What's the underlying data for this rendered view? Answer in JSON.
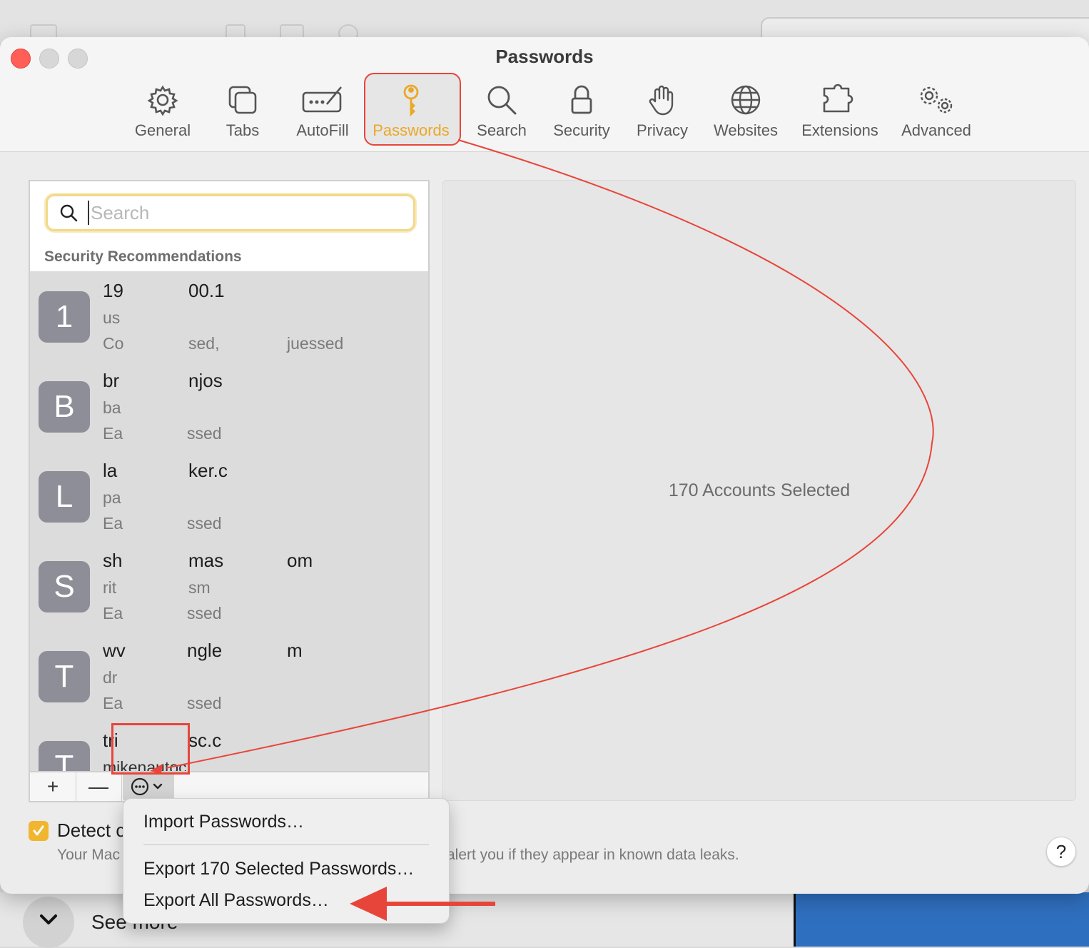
{
  "background": {
    "see_more_label": "See more"
  },
  "window": {
    "title": "Passwords",
    "tabs": [
      {
        "label": "General",
        "icon": "gear-icon"
      },
      {
        "label": "Tabs",
        "icon": "tabs-icon"
      },
      {
        "label": "AutoFill",
        "icon": "autofill-icon"
      },
      {
        "label": "Passwords",
        "icon": "key-icon",
        "active": true
      },
      {
        "label": "Search",
        "icon": "magnifier-icon"
      },
      {
        "label": "Security",
        "icon": "lock-icon"
      },
      {
        "label": "Privacy",
        "icon": "hand-icon"
      },
      {
        "label": "Websites",
        "icon": "globe-icon"
      },
      {
        "label": "Extensions",
        "icon": "puzzle-icon"
      },
      {
        "label": "Advanced",
        "icon": "gears-icon"
      }
    ]
  },
  "search": {
    "placeholder": "Search",
    "value": ""
  },
  "list": {
    "section_header": "Security Recommendations",
    "rows": [
      {
        "letter": "1",
        "line1": "19",
        "line1b": "00.1",
        "line2": "us",
        "line3": "Co",
        "line3b": "sed,",
        "line3c": "juessed"
      },
      {
        "letter": "B",
        "line1": "br",
        "line1b": "njos",
        "line2": "ba",
        "line3": "Ea",
        "line3b": "ssed",
        "line3c": ""
      },
      {
        "letter": "L",
        "line1": "la",
        "line1b": "ker.c",
        "line2": "pa",
        "line3": "Ea",
        "line3b": "ssed",
        "line3c": ""
      },
      {
        "letter": "S",
        "line1": "sh",
        "line1b": "mas",
        "line1c": "om",
        "line2": "rit",
        "line2b": "sm",
        "line3": "Ea",
        "line3b": "ssed",
        "line3c": ""
      },
      {
        "letter": "T",
        "line1": "wv",
        "line1b": "ngle",
        "line1c": "m",
        "line2": "dr",
        "line3": "Ea",
        "line3b": "ssed",
        "line3c": ""
      },
      {
        "letter": "T",
        "line1": "tri",
        "line1b": "sc.c",
        "line2": "mikenautoc",
        "line3": "",
        "line3b": "",
        "line3c": ""
      }
    ]
  },
  "bottom_bar": {
    "add_label": "+",
    "remove_label": "—"
  },
  "detail": {
    "text": "170 Accounts Selected"
  },
  "detect": {
    "label": "Detect c",
    "desc_left": "Your Mac",
    "desc_right": "alert you if they appear in known data leaks."
  },
  "help_label": "?",
  "menu": {
    "items": [
      "Import Passwords…",
      "Export 170 Selected Passwords…",
      "Export All Passwords…"
    ]
  },
  "colors": {
    "accent": "#e9a826",
    "annotation_red": "#e8453a"
  }
}
